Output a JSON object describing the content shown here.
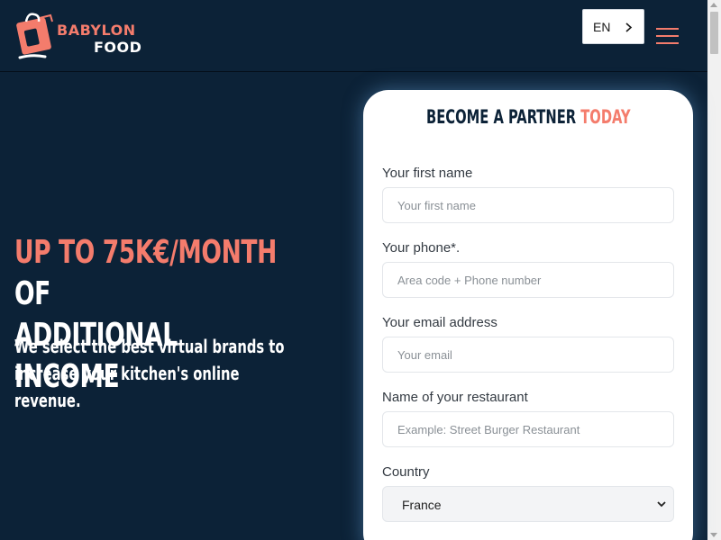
{
  "brand": {
    "line1": "BABYLON",
    "line2": "FOOD",
    "accent_color": "#f47c6c",
    "background_color": "#0c2237"
  },
  "header": {
    "language": "EN",
    "language_icon": "chevron-right-icon",
    "menu_icon": "hamburger-menu-icon"
  },
  "hero": {
    "title_accent": "UP TO 75K€/MONTH",
    "title_rest_1": "OF",
    "title_rest_2": "ADDITIONAL INCOME",
    "subtitle_line1": "We select the best virtual brands to",
    "subtitle_line2": "increase your kitchen's online revenue."
  },
  "form": {
    "title_main": "BECOME A PARTNER",
    "title_accent": "TODAY",
    "fields": [
      {
        "label": "Your first name",
        "placeholder": "Your first name",
        "value": ""
      },
      {
        "label": "Your phone*.",
        "placeholder": "Area code + Phone number",
        "value": ""
      },
      {
        "label": "Your email address",
        "placeholder": "Your email",
        "value": ""
      },
      {
        "label": "Name of your restaurant",
        "placeholder": "Example: Street Burger Restaurant",
        "value": ""
      }
    ],
    "country": {
      "label": "Country",
      "selected": "France",
      "icon": "chevron-down-icon"
    }
  }
}
